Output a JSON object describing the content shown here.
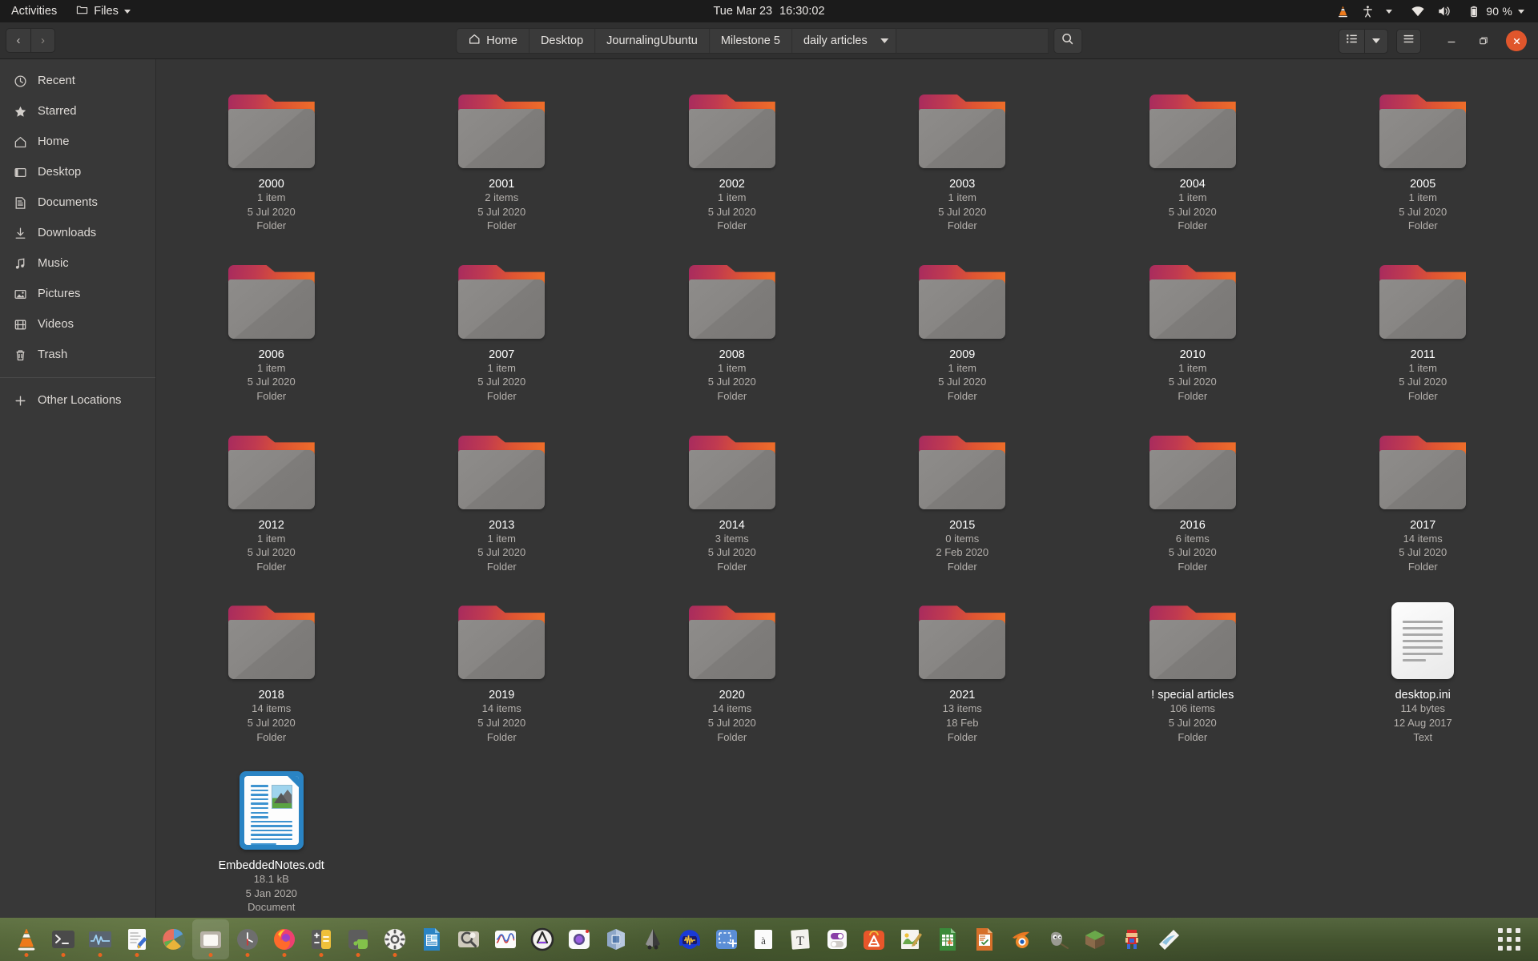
{
  "topbar": {
    "activities": "Activities",
    "app_menu": {
      "label": "Files",
      "icon": "folder-icon"
    },
    "clock": {
      "date": "Tue Mar 23",
      "time": "16:30:02"
    },
    "tray": {
      "vlc_icon": "vlc-cone-icon",
      "accessibility_icon": "accessibility-icon",
      "network_icon": "wifi-icon",
      "volume_icon": "speaker-icon",
      "battery_icon": "battery-icon",
      "battery_label": "90 %"
    }
  },
  "headerbar": {
    "back_label": "‹",
    "forward_label": "›",
    "breadcrumbs": [
      {
        "label": "Home",
        "icon": "home-icon"
      },
      {
        "label": "Desktop"
      },
      {
        "label": "JournalingUbuntu"
      },
      {
        "label": "Milestone 5"
      },
      {
        "label": "daily articles",
        "has_dropdown": true
      }
    ],
    "path_entry_value": "",
    "search_icon": "search-icon",
    "view_toggle_icon": "list-view-icon",
    "view_dropdown_icon": "chevron-down-icon",
    "menu_icon": "hamburger-menu-icon",
    "minimize_label": "—",
    "maximize_label": "❐",
    "close_label": "✕"
  },
  "sidebar": {
    "items": [
      {
        "label": "Recent",
        "icon": "clock-icon"
      },
      {
        "label": "Starred",
        "icon": "star-icon"
      },
      {
        "label": "Home",
        "icon": "home-icon"
      },
      {
        "label": "Desktop",
        "icon": "desktop-icon"
      },
      {
        "label": "Documents",
        "icon": "documents-icon"
      },
      {
        "label": "Downloads",
        "icon": "download-icon"
      },
      {
        "label": "Music",
        "icon": "music-note-icon"
      },
      {
        "label": "Pictures",
        "icon": "picture-icon"
      },
      {
        "label": "Videos",
        "icon": "video-icon"
      },
      {
        "label": "Trash",
        "icon": "trash-icon"
      }
    ],
    "other_locations": {
      "label": "Other Locations",
      "icon": "plus-icon"
    }
  },
  "files": [
    {
      "name": "2000",
      "kind": "folder",
      "items": "1 item",
      "date": "5 Jul 2020",
      "type": "Folder"
    },
    {
      "name": "2001",
      "kind": "folder",
      "items": "2 items",
      "date": "5 Jul 2020",
      "type": "Folder"
    },
    {
      "name": "2002",
      "kind": "folder",
      "items": "1 item",
      "date": "5 Jul 2020",
      "type": "Folder"
    },
    {
      "name": "2003",
      "kind": "folder",
      "items": "1 item",
      "date": "5 Jul 2020",
      "type": "Folder"
    },
    {
      "name": "2004",
      "kind": "folder",
      "items": "1 item",
      "date": "5 Jul 2020",
      "type": "Folder"
    },
    {
      "name": "2005",
      "kind": "folder",
      "items": "1 item",
      "date": "5 Jul 2020",
      "type": "Folder"
    },
    {
      "name": "2006",
      "kind": "folder",
      "items": "1 item",
      "date": "5 Jul 2020",
      "type": "Folder"
    },
    {
      "name": "2007",
      "kind": "folder",
      "items": "1 item",
      "date": "5 Jul 2020",
      "type": "Folder"
    },
    {
      "name": "2008",
      "kind": "folder",
      "items": "1 item",
      "date": "5 Jul 2020",
      "type": "Folder"
    },
    {
      "name": "2009",
      "kind": "folder",
      "items": "1 item",
      "date": "5 Jul 2020",
      "type": "Folder"
    },
    {
      "name": "2010",
      "kind": "folder",
      "items": "1 item",
      "date": "5 Jul 2020",
      "type": "Folder"
    },
    {
      "name": "2011",
      "kind": "folder",
      "items": "1 item",
      "date": "5 Jul 2020",
      "type": "Folder"
    },
    {
      "name": "2012",
      "kind": "folder",
      "items": "1 item",
      "date": "5 Jul 2020",
      "type": "Folder"
    },
    {
      "name": "2013",
      "kind": "folder",
      "items": "1 item",
      "date": "5 Jul 2020",
      "type": "Folder"
    },
    {
      "name": "2014",
      "kind": "folder",
      "items": "3 items",
      "date": "5 Jul 2020",
      "type": "Folder"
    },
    {
      "name": "2015",
      "kind": "folder",
      "items": "0 items",
      "date": "2 Feb 2020",
      "type": "Folder"
    },
    {
      "name": "2016",
      "kind": "folder",
      "items": "6 items",
      "date": "5 Jul 2020",
      "type": "Folder"
    },
    {
      "name": "2017",
      "kind": "folder",
      "items": "14 items",
      "date": "5 Jul 2020",
      "type": "Folder"
    },
    {
      "name": "2018",
      "kind": "folder",
      "items": "14 items",
      "date": "5 Jul 2020",
      "type": "Folder"
    },
    {
      "name": "2019",
      "kind": "folder",
      "items": "14 items",
      "date": "5 Jul 2020",
      "type": "Folder"
    },
    {
      "name": "2020",
      "kind": "folder",
      "items": "14 items",
      "date": "5 Jul 2020",
      "type": "Folder"
    },
    {
      "name": "2021",
      "kind": "folder",
      "items": "13 items",
      "date": "18 Feb",
      "type": "Folder"
    },
    {
      "name": "! special articles",
      "kind": "folder",
      "items": "106 items",
      "date": "5 Jul 2020",
      "type": "Folder"
    },
    {
      "name": "desktop.ini",
      "kind": "textfile",
      "items": "114 bytes",
      "date": "12 Aug 2017",
      "type": "Text"
    },
    {
      "name": "EmbeddedNotes.odt",
      "kind": "odt",
      "items": "18.1 kB",
      "date": "5 Jan 2020",
      "type": "Document"
    }
  ],
  "dock": {
    "items": [
      {
        "icon": "vlc-icon",
        "running": true
      },
      {
        "icon": "terminal-icon",
        "running": true
      },
      {
        "icon": "system-monitor-icon",
        "running": true
      },
      {
        "icon": "text-editor-icon",
        "running": true
      },
      {
        "icon": "disk-usage-icon",
        "running": false
      },
      {
        "icon": "files-icon",
        "running": true,
        "active": true
      },
      {
        "icon": "clocks-icon",
        "running": true
      },
      {
        "icon": "firefox-icon",
        "running": true
      },
      {
        "icon": "calculator-icon",
        "running": true
      },
      {
        "icon": "extensions-icon",
        "running": true
      },
      {
        "icon": "settings-icon",
        "running": true
      },
      {
        "icon": "libreoffice-writer-icon",
        "running": false
      },
      {
        "icon": "search-tool-icon",
        "running": false
      },
      {
        "icon": "graph-plot-icon",
        "running": false
      },
      {
        "icon": "ardour-icon",
        "running": false
      },
      {
        "icon": "camera-icon",
        "running": false
      },
      {
        "icon": "virtualbox-icon",
        "running": false
      },
      {
        "icon": "inkscape-icon",
        "running": false
      },
      {
        "icon": "audacity-icon",
        "running": false
      },
      {
        "icon": "screenshot-icon",
        "running": false
      },
      {
        "icon": "character-map-icon",
        "running": false
      },
      {
        "icon": "fonts-icon",
        "running": false
      },
      {
        "icon": "tweaks-icon",
        "running": false
      },
      {
        "icon": "ubuntu-software-icon",
        "running": false
      },
      {
        "icon": "libreoffice-draw-icon",
        "running": false
      },
      {
        "icon": "libreoffice-calc-icon",
        "running": false
      },
      {
        "icon": "libreoffice-impress-icon",
        "running": false
      },
      {
        "icon": "blender-icon",
        "running": false
      },
      {
        "icon": "gimp-icon",
        "running": false
      },
      {
        "icon": "minecraft-icon",
        "running": false
      },
      {
        "icon": "game-sprite-icon",
        "running": false
      },
      {
        "icon": "paper-app-icon",
        "running": false
      }
    ],
    "show_apps_icon": "app-grid-icon"
  },
  "colors": {
    "accent": "#e8641f",
    "close_button": "#e0562c",
    "window_bg": "#353535",
    "sidebar_bg": "#383838",
    "headerbar_bg": "#303030",
    "topbar_bg": "#1b1b1b"
  }
}
